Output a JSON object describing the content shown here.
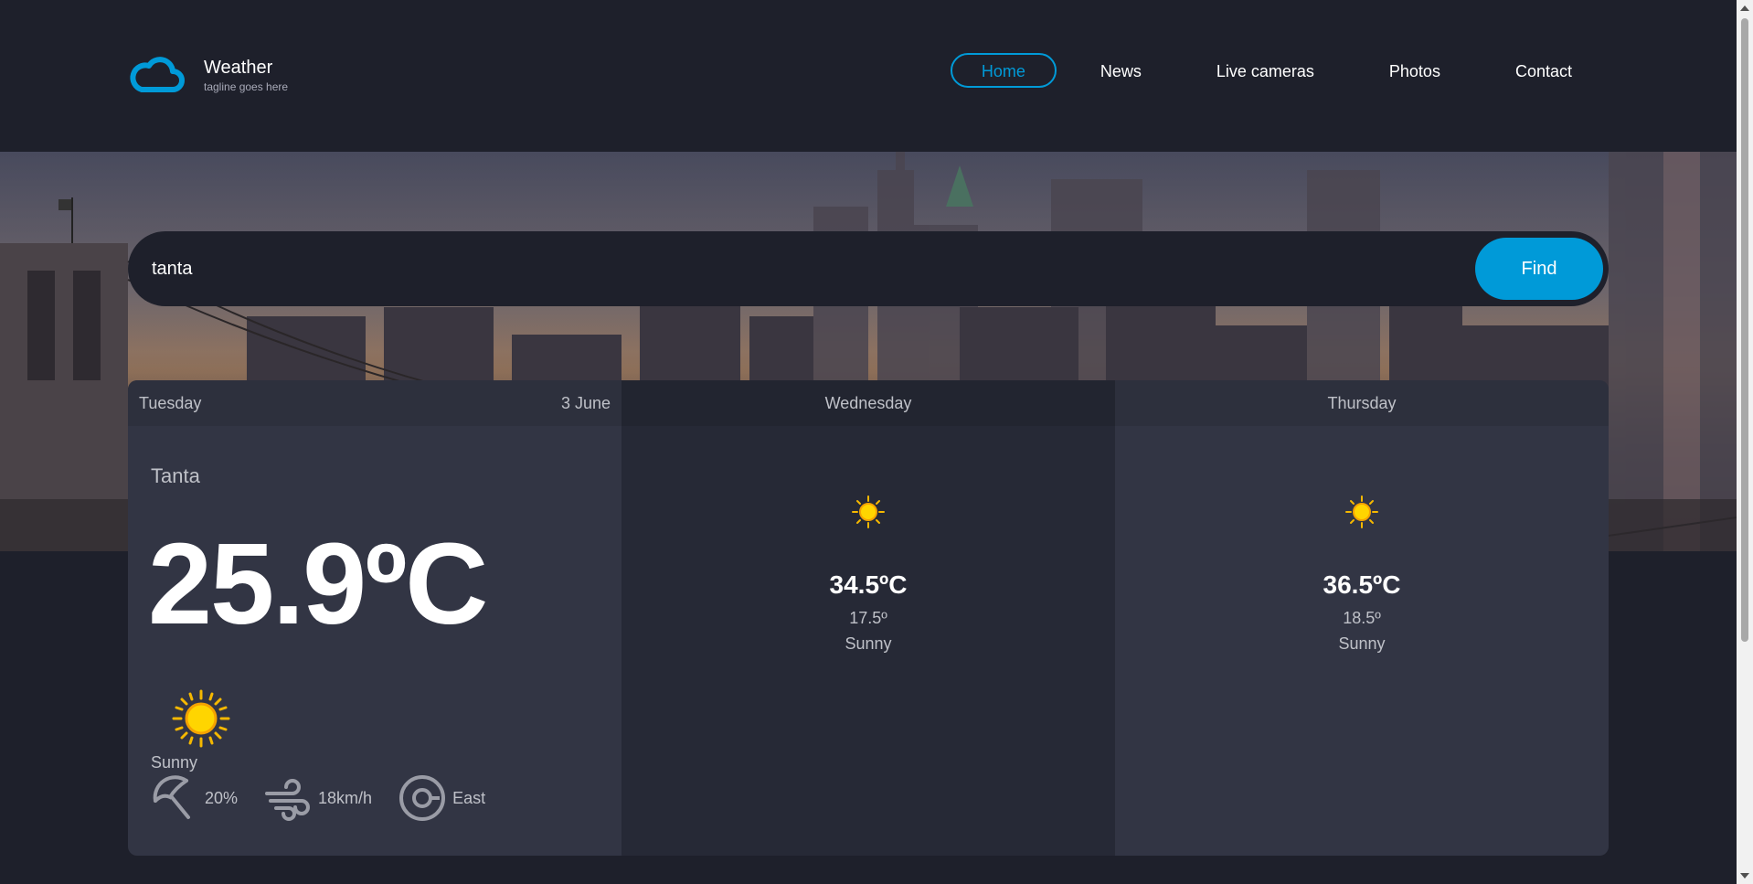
{
  "brand": {
    "name": "Weather",
    "tagline": "tagline goes here",
    "logo_icon": "cloud-icon",
    "accent_color": "#009ad8"
  },
  "nav": {
    "items": [
      {
        "label": "Home",
        "active": true
      },
      {
        "label": "News",
        "active": false
      },
      {
        "label": "Live cameras",
        "active": false
      },
      {
        "label": "Photos",
        "active": false
      },
      {
        "label": "Contact",
        "active": false
      }
    ]
  },
  "search": {
    "value": "tanta",
    "button_label": "Find"
  },
  "today": {
    "day": "Tuesday",
    "date": "3 June",
    "location": "Tanta",
    "temperature": "25.9ºC",
    "condition": "Sunny",
    "icon": "sun-icon",
    "rain": "20%",
    "wind_speed": "18km/h",
    "wind_direction": "East"
  },
  "forecast": [
    {
      "day": "Wednesday",
      "max": "34.5ºC",
      "min": "17.5º",
      "condition": "Sunny",
      "icon": "sun-icon"
    },
    {
      "day": "Thursday",
      "max": "36.5ºC",
      "min": "18.5º",
      "condition": "Sunny",
      "icon": "sun-icon"
    }
  ]
}
